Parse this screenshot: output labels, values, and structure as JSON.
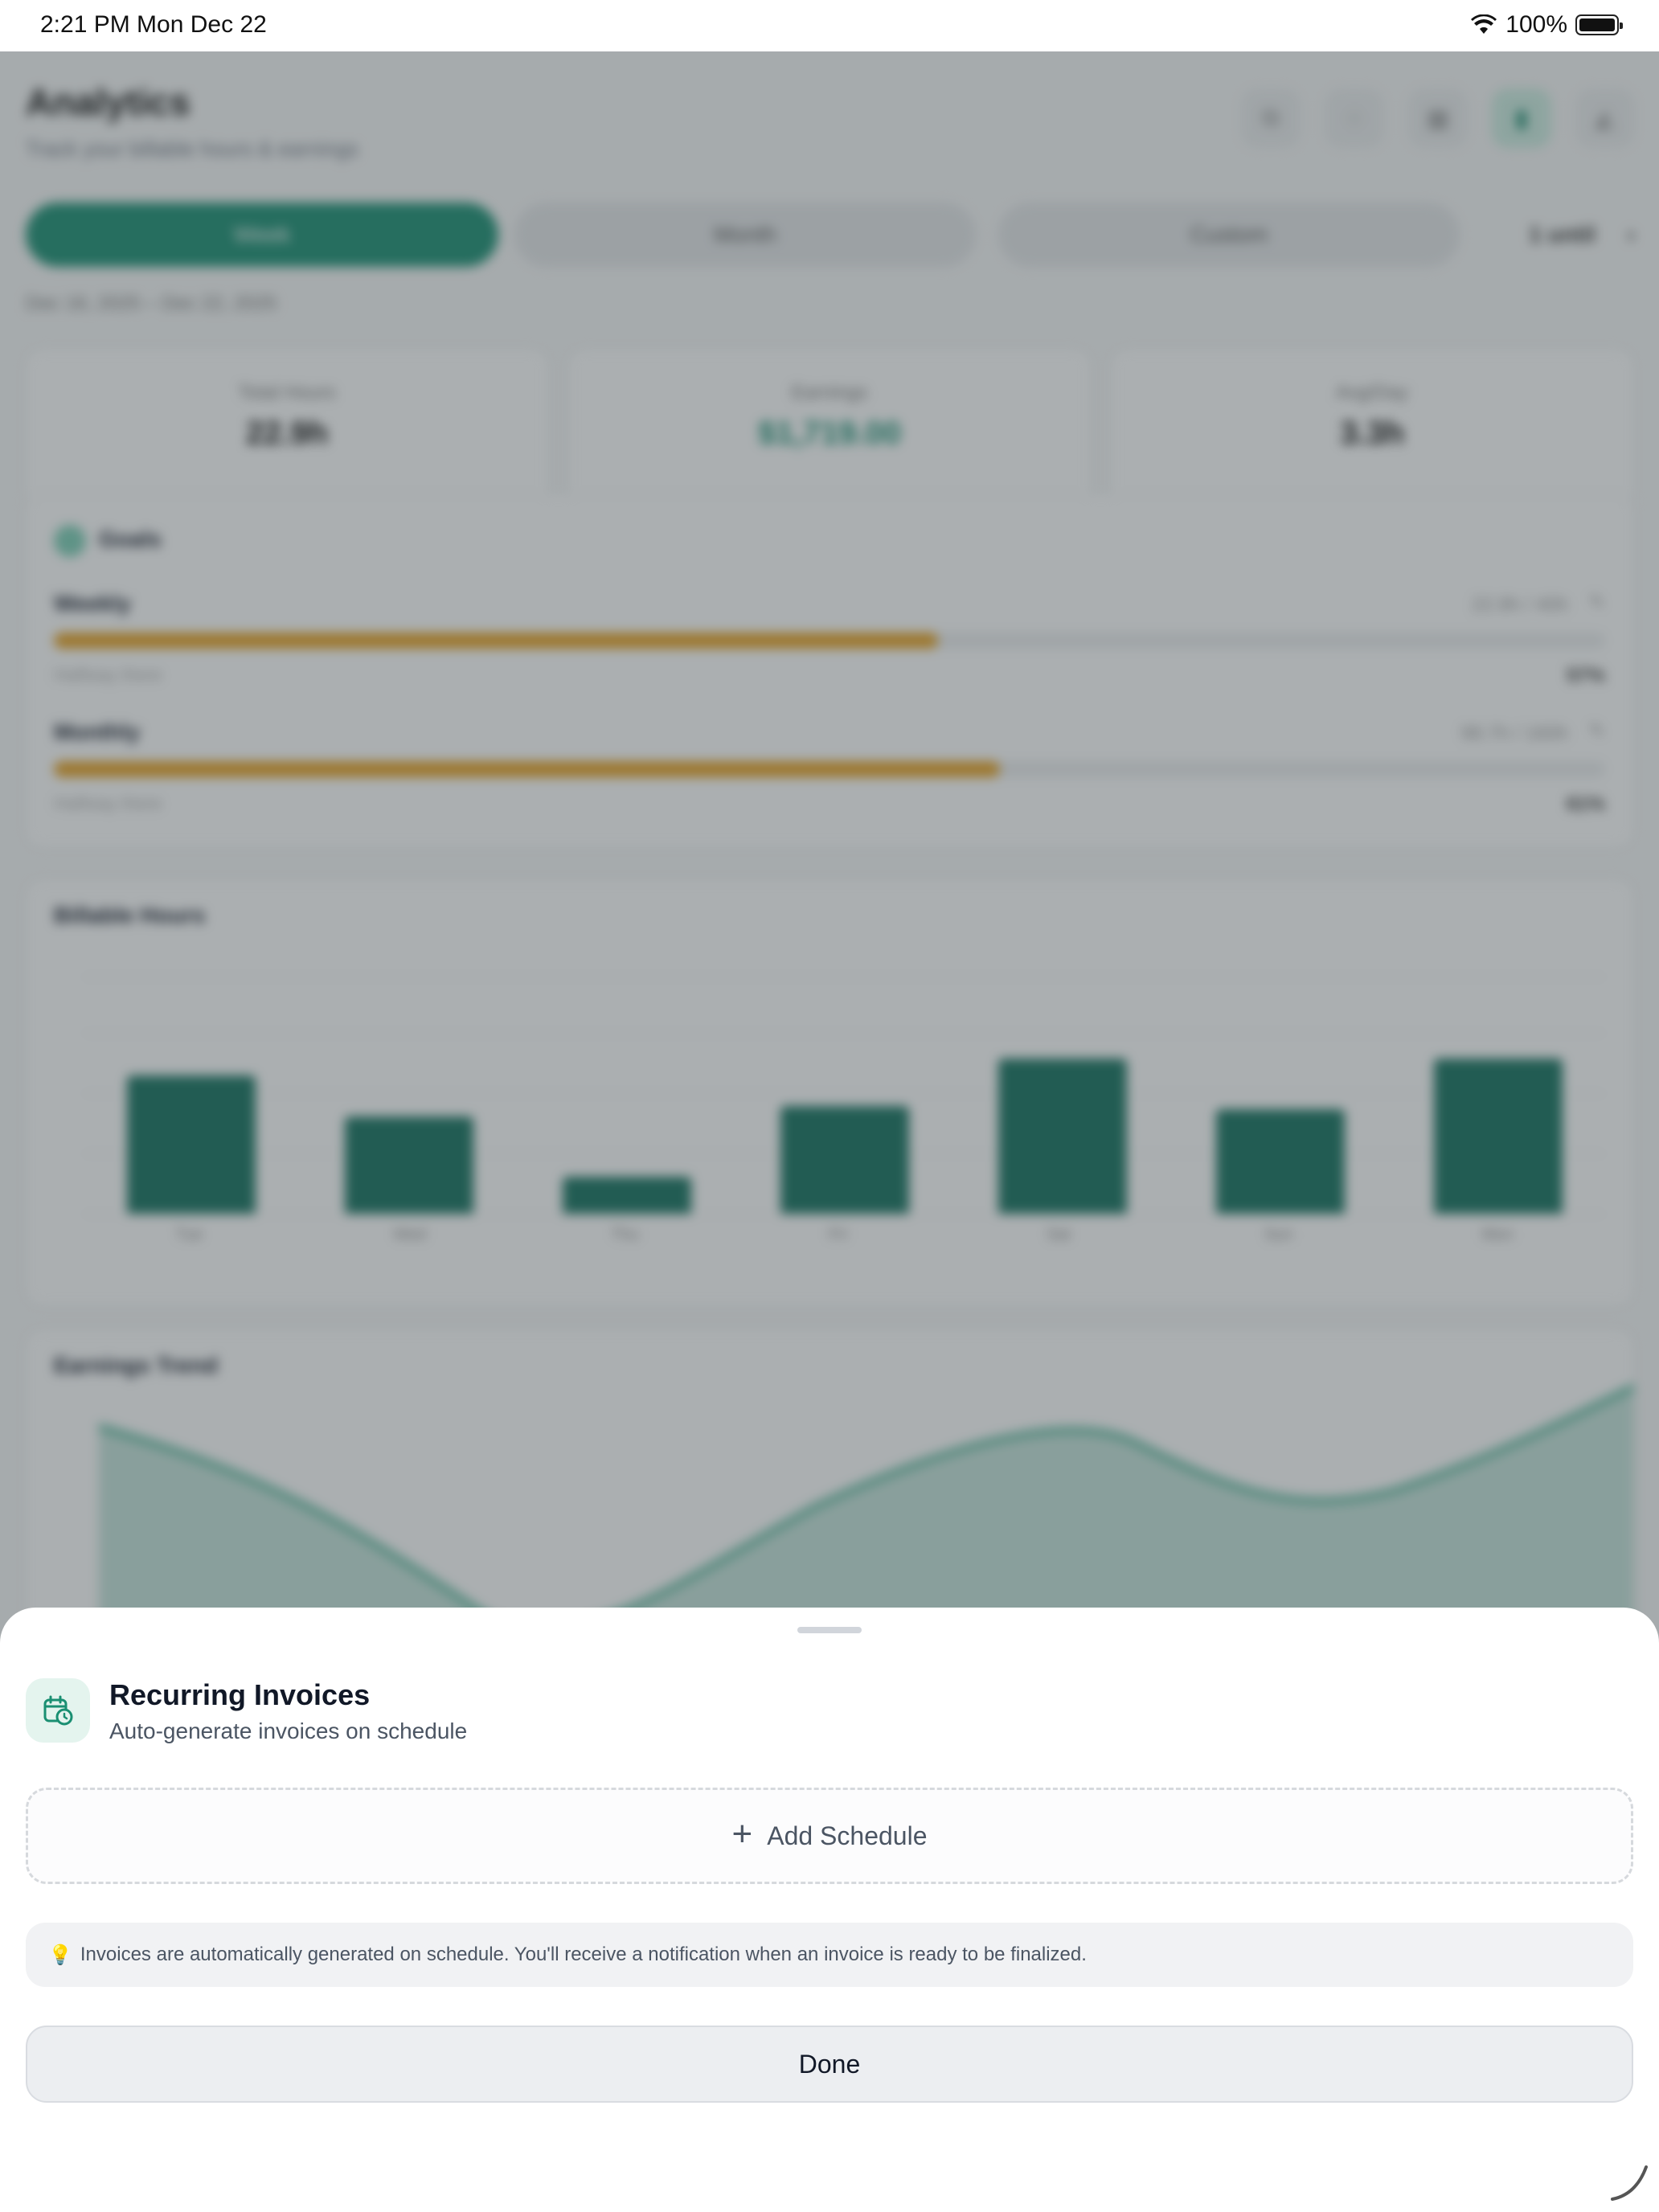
{
  "status_bar": {
    "time": "2:21 PM   Mon Dec 22",
    "battery_pct": "100%"
  },
  "background": {
    "title": "Analytics",
    "subtitle": "Track your billable hours & earnings",
    "segments": [
      "Week",
      "Month",
      "Custom"
    ],
    "selected_segment": "Week",
    "range_extra": "1 until",
    "date_range": "Dec 16, 2025 – Dec 22, 2025",
    "stats": [
      {
        "label": "Total Hours",
        "value": "22.9h"
      },
      {
        "label": "Earnings",
        "value": "$1,719.00"
      },
      {
        "label": "Avg/Day",
        "value": "3.3h"
      }
    ],
    "goals": {
      "title": "Goals",
      "items": [
        {
          "name": "Weekly",
          "right": "22.9h / 40h",
          "sub": "Halfway there",
          "pct": "57%",
          "fraction": 0.57
        },
        {
          "name": "Monthly",
          "right": "98.7h / 160h",
          "sub": "Halfway there",
          "pct": "61%",
          "fraction": 0.61
        }
      ]
    },
    "hours_chart": {
      "title": "Billable Hours",
      "categories": [
        "Tue",
        "Wed",
        "Thu",
        "Fri",
        "Sat",
        "Sun",
        "Mon"
      ],
      "values": [
        4.1,
        2.9,
        1.1,
        3.2,
        4.6,
        3.1,
        4.6
      ],
      "ylim": [
        0,
        8
      ]
    },
    "earnings_chart": {
      "title": "Earnings Trend"
    }
  },
  "sheet": {
    "title": "Recurring Invoices",
    "subtitle": "Auto-generate invoices on schedule",
    "add_label": "Add Schedule",
    "tip": "Invoices are automatically generated on schedule. You'll receive a notification when an invoice is ready to be finalized.",
    "done_label": "Done",
    "accent_color": "#1a8f72"
  }
}
